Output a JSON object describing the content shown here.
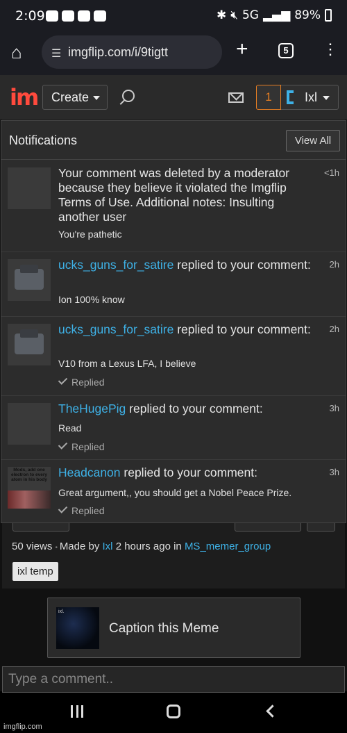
{
  "status_bar": {
    "time": "2:09",
    "signal": "5G",
    "battery": "89%"
  },
  "browser": {
    "url": "imgflip.com/i/9tigtt",
    "tab_count": "5"
  },
  "header": {
    "create_label": "Create",
    "notification_count": "1",
    "username": "Ixl"
  },
  "notifications": {
    "title": "Notifications",
    "view_all": "View All",
    "items": [
      {
        "text": "Your comment was deleted by a moderator because they believe it violated the Imgflip Terms of Use. Additional notes: Insulting another user",
        "quote": "You're pathetic",
        "time": "<1h"
      },
      {
        "user": "ucks_guns_for_satire",
        "action": " replied to your comment:",
        "quote": "Ion 100% know",
        "time": "2h"
      },
      {
        "user": "ucks_guns_for_satire",
        "action": " replied to your comment:",
        "quote": "V10 from a Lexus LFA, I believe",
        "time": "2h",
        "replied": "Replied"
      },
      {
        "user": "TheHugePig",
        "action": " replied to your comment:",
        "quote": "Read",
        "time": "3h",
        "replied": "Replied"
      },
      {
        "user": "Headcanon",
        "action": " replied to your comment:",
        "quote": "Great argument,, you should get a Nobel Peace Prize.",
        "time": "3h",
        "replied": "Replied",
        "thumb_caption": "Mods, add one electron to every atom in his body"
      }
    ]
  },
  "meme": {
    "views": "50 views",
    "made_by_prefix": "Made by ",
    "author": "Ixl",
    "time_text": " 2 hours ago in ",
    "stream": "MS_memer_group",
    "tag": "ixl temp",
    "caption_label": "Caption this Meme"
  },
  "comment": {
    "placeholder": "Type a comment.."
  },
  "watermark": "imgflip.com"
}
